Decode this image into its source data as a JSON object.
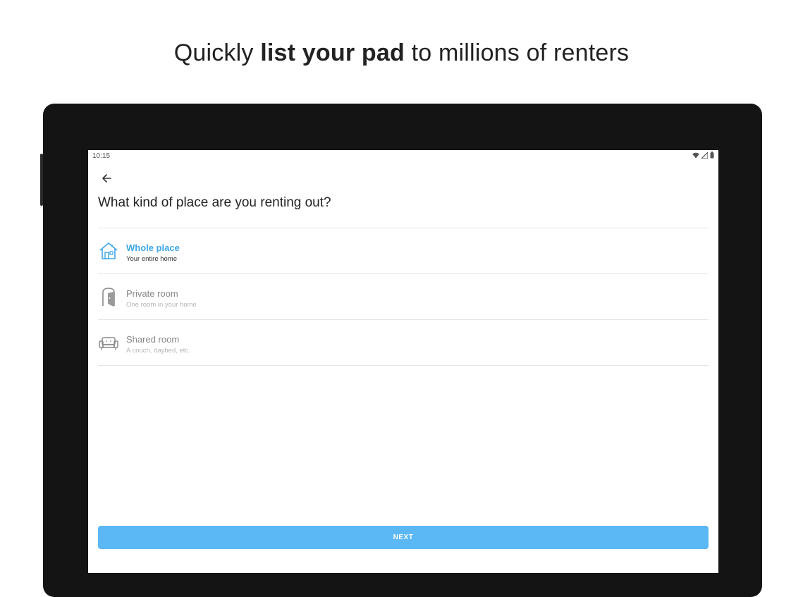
{
  "headline": {
    "pre": "Quickly ",
    "bold": "list your pad",
    "post": " to millions of renters"
  },
  "status_bar": {
    "time": "10:15",
    "icons": [
      "wifi-icon",
      "signal-icon",
      "battery-icon"
    ]
  },
  "screen": {
    "question": "What kind of place are you renting out?",
    "options": [
      {
        "title": "Whole place",
        "subtitle": "Your entire home",
        "icon": "house-icon",
        "selected": true
      },
      {
        "title": "Private room",
        "subtitle": "One room in your home",
        "icon": "door-icon",
        "selected": false
      },
      {
        "title": "Shared room",
        "subtitle": "A couch, daybed, etc.",
        "icon": "couch-icon",
        "selected": false
      }
    ],
    "next_label": "NEXT"
  },
  "colors": {
    "accent": "#3fa7e8",
    "button": "#5bb8f5",
    "device": "#141414"
  }
}
